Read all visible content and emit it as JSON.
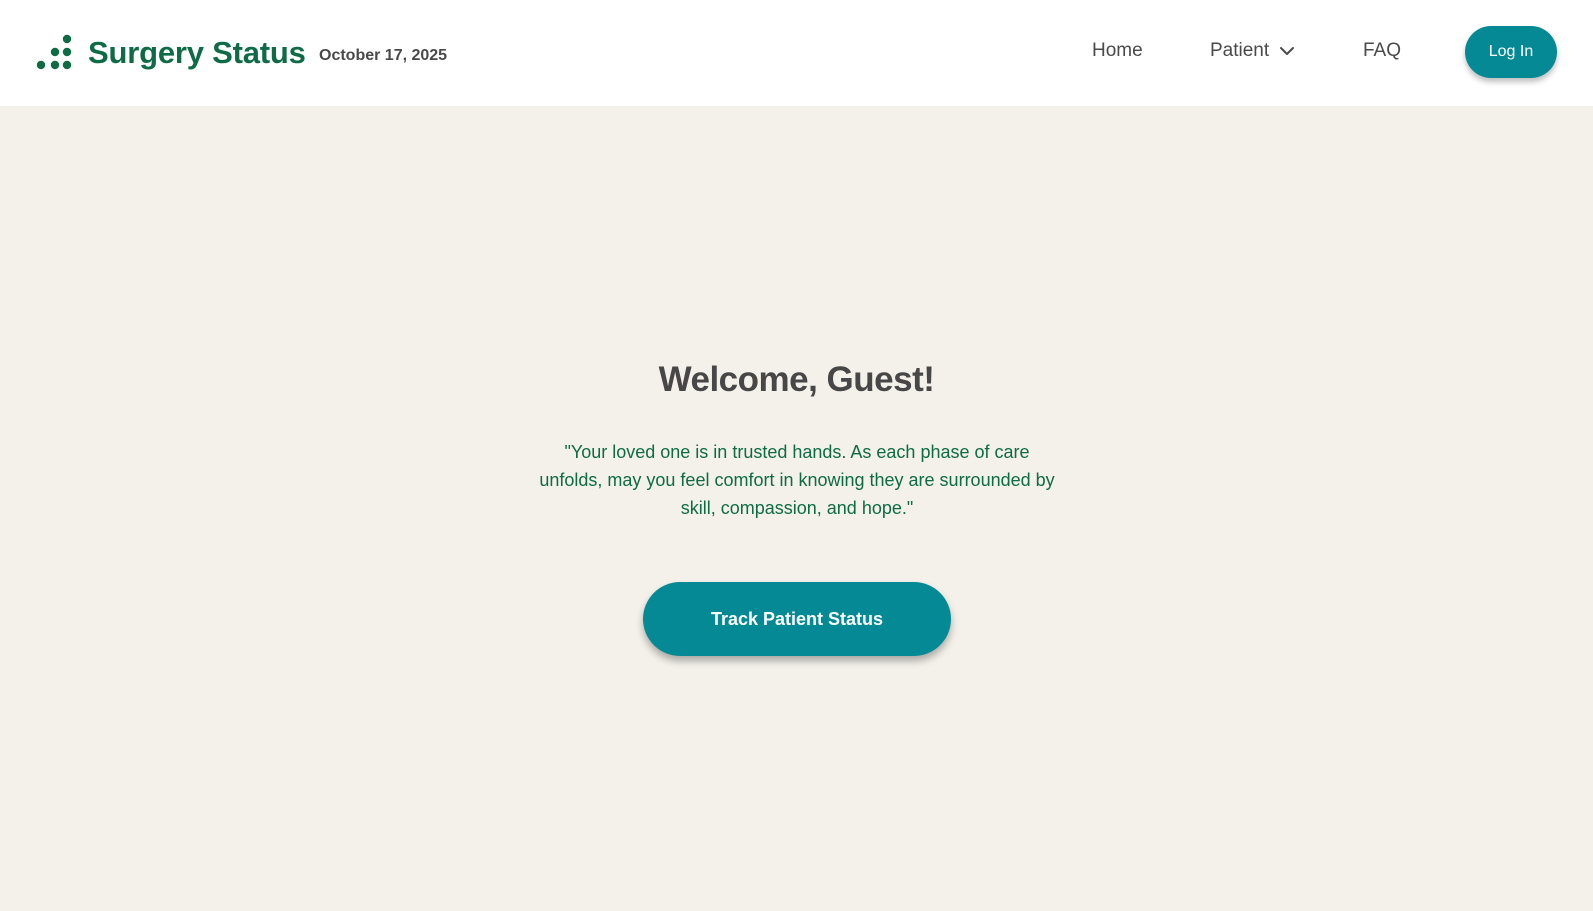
{
  "header": {
    "brand_name": "Surgery Status",
    "logo_icon": "dots-logo-icon",
    "date": "October 17, 2025"
  },
  "nav": {
    "home_label": "Home",
    "patient_label": "Patient",
    "faq_label": "FAQ",
    "login_label": "Log In",
    "patient_icon": "chevron-down-icon"
  },
  "hero": {
    "title": "Welcome, Guest!",
    "quote": "\"Your loved one is in trusted hands. As each phase of care unfolds, may you feel comfort in knowing they are surrounded by skill, compassion, and hope.\"",
    "cta_label": "Track Patient Status"
  },
  "colors": {
    "brand_green": "#0e6b46",
    "accent_teal": "#058a95",
    "background": "#f4f1ea",
    "header_bg": "#ffffff",
    "text_dark": "#474747"
  }
}
